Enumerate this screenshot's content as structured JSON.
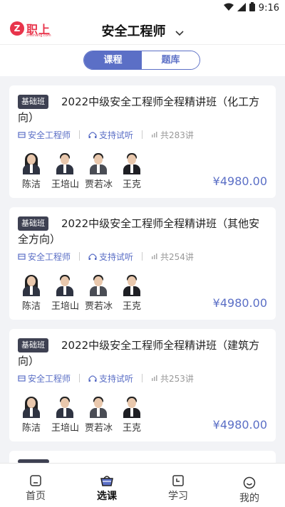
{
  "status": {
    "time": "9:16"
  },
  "header": {
    "logo_text": "职上",
    "logo_sub": "zhishang.com",
    "title": "安全工程师"
  },
  "tabs": [
    {
      "label": "课程",
      "active": true
    },
    {
      "label": "题库",
      "active": false
    }
  ],
  "courses": [
    {
      "badge": "基础班",
      "title": "2022中级安全工程师全程精讲班（化工方向）",
      "tag_subject": "安全工程师",
      "tag_trial": "支持试听",
      "lessons": "共283讲",
      "teachers": [
        "陈洁",
        "王培山",
        "贾若冰",
        "王克"
      ],
      "price": "¥4980.00"
    },
    {
      "badge": "基础班",
      "title": "2022中级安全工程师全程精讲班（其他安全方向）",
      "tag_subject": "安全工程师",
      "tag_trial": "支持试听",
      "lessons": "共254讲",
      "teachers": [
        "陈洁",
        "王培山",
        "贾若冰",
        "王克"
      ],
      "price": "¥4980.00"
    },
    {
      "badge": "基础班",
      "title": "2022中级安全工程师全程精讲班（建筑方向）",
      "tag_subject": "安全工程师",
      "tag_trial": "支持试听",
      "lessons": "共253讲",
      "teachers": [
        "陈洁",
        "王培山",
        "贾若冰",
        "王克"
      ],
      "price": "¥4980.00"
    }
  ],
  "nav": [
    {
      "label": "首页",
      "icon": "home-icon"
    },
    {
      "label": "选课",
      "icon": "basket-icon",
      "active": true
    },
    {
      "label": "学习",
      "icon": "study-icon"
    },
    {
      "label": "我的",
      "icon": "profile-icon"
    }
  ],
  "colors": {
    "accent": "#5b6fc6",
    "brand": "#e8344b",
    "badge": "#3e4152"
  }
}
